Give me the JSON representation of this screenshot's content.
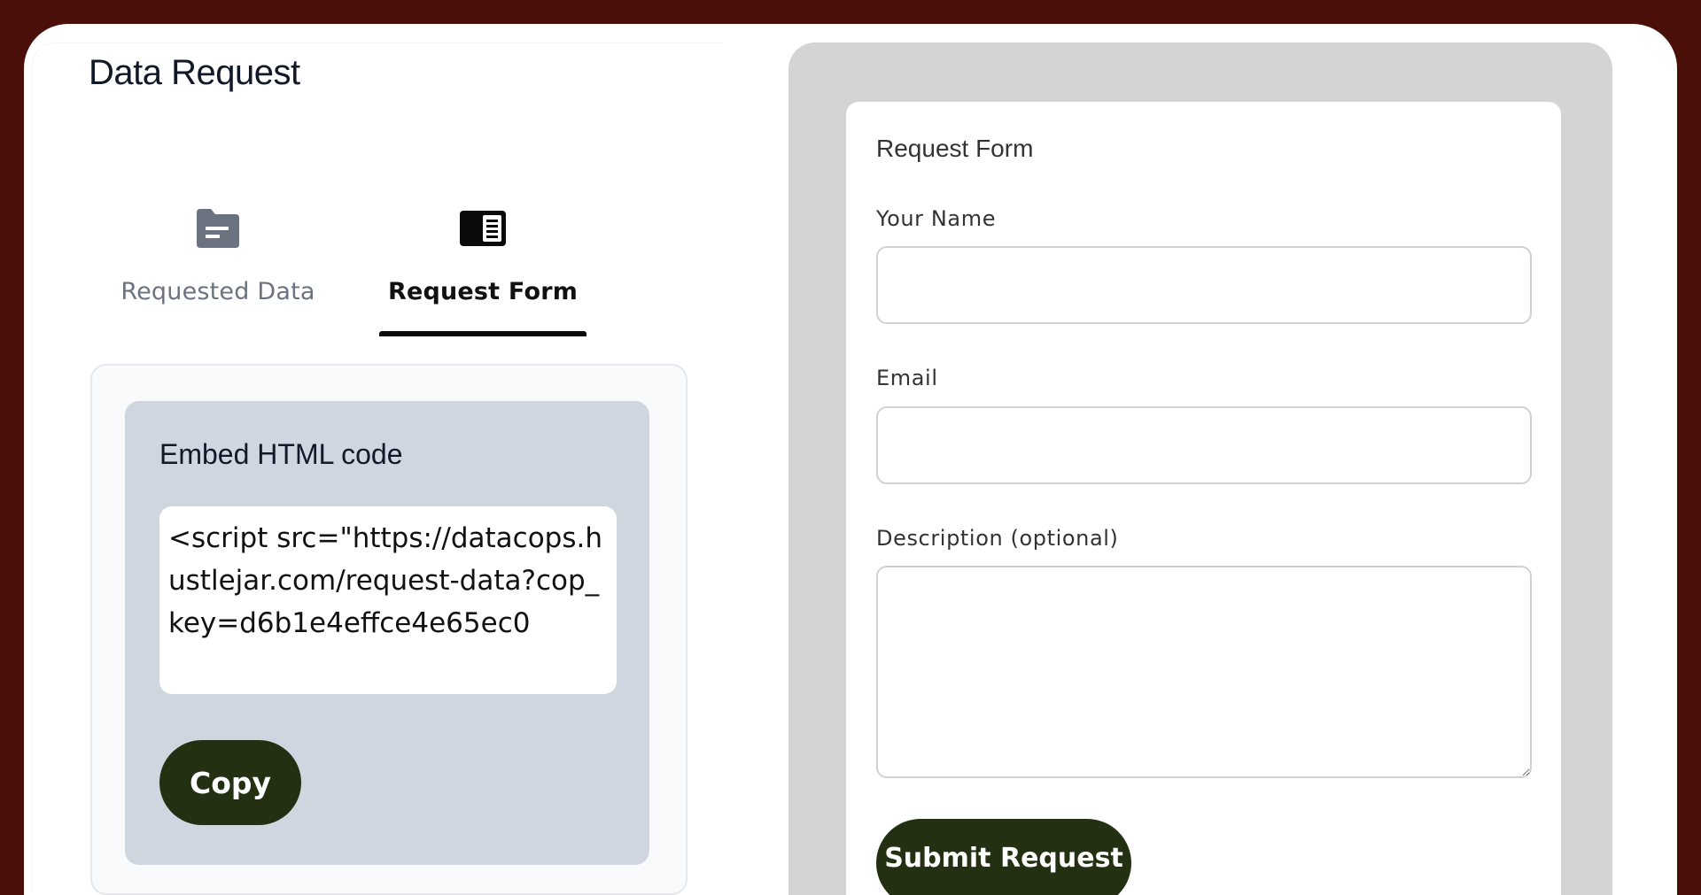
{
  "page": {
    "title": "Data Request"
  },
  "tabs": [
    {
      "label": "Requested Data",
      "icon": "folder-document-icon",
      "active": false
    },
    {
      "label": "Request Form",
      "icon": "form-layout-icon",
      "active": true
    }
  ],
  "embed": {
    "title": "Embed HTML code",
    "code": "<script src=\"https://datacops.hustlejar.com/request-data?cop_key=d6b1e4effce4e65ec0",
    "copy_label": "Copy"
  },
  "form": {
    "title": "Request Form",
    "fields": {
      "name": {
        "label": "Your Name",
        "value": "",
        "placeholder": ""
      },
      "email": {
        "label": "Email",
        "value": "",
        "placeholder": ""
      },
      "description": {
        "label": "Description (optional)",
        "value": "",
        "placeholder": ""
      }
    },
    "submit_label": "Submit Request"
  },
  "colors": {
    "frame": "#4a0f09",
    "button": "#233012",
    "embed_panel": "#cfd6e0",
    "preview_bg": "#d4d4d4"
  }
}
